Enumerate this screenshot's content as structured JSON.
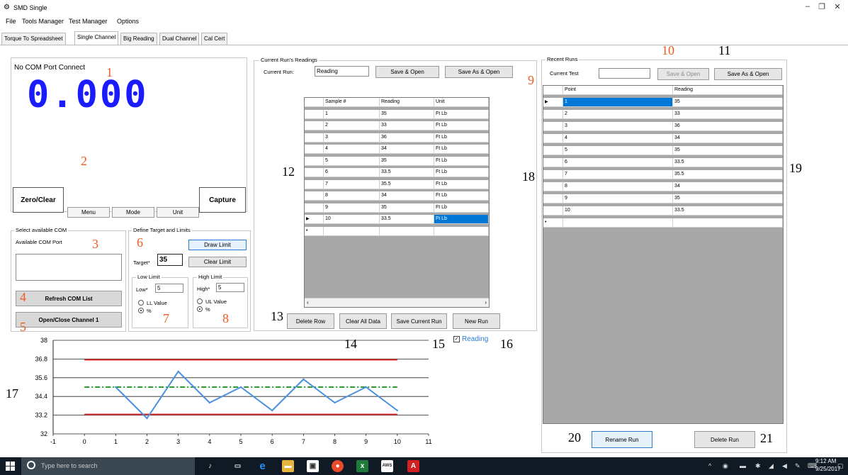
{
  "window": {
    "title": "SMD Single",
    "minimize": "–",
    "maximize": "❐",
    "close": "✕"
  },
  "menu": [
    "File",
    "Tools Manager",
    "Test Manager",
    "Options"
  ],
  "tabs": [
    "Torque To Spreadsheet",
    "Single Channel",
    "Big Reading",
    "Dual Channel",
    "Cal Cert"
  ],
  "display": {
    "status": "No COM Port Connect",
    "reading": "0.000",
    "zero_clear": "Zero/Clear",
    "capture": "Capture",
    "menu_btn": "Menu",
    "mode_btn": "Mode",
    "unit_btn": "Unit"
  },
  "com": {
    "group_title": "Select available COM",
    "label": "Available COM Port",
    "refresh": "Refresh COM List",
    "open_close": "Open/Close Channel 1"
  },
  "limits": {
    "group_title": "Define Target and Limits",
    "target_label": "Target*",
    "target_value": "35",
    "draw_limit": "Draw Limit",
    "clear_limit": "Clear Limit",
    "low_title": "Low Limit",
    "low_label": "Low*",
    "low_value": "5",
    "ll_value": "LL Value",
    "low_pct": "%",
    "high_title": "High Limit",
    "high_label": "High*",
    "high_value": "5",
    "ul_value": "UL Value",
    "high_pct": "%"
  },
  "current_run": {
    "group_title": "Current Run's Readings",
    "label": "Current Run:",
    "value": "Reading",
    "save_open": "Save & Open",
    "save_as_open": "Save As & Open",
    "columns": [
      "Sample #",
      "Reading",
      "Unit"
    ],
    "rows": [
      [
        "1",
        "35",
        "Ft Lb"
      ],
      [
        "2",
        "33",
        "Ft Lb"
      ],
      [
        "3",
        "36",
        "Ft Lb"
      ],
      [
        "4",
        "34",
        "Ft Lb"
      ],
      [
        "5",
        "35",
        "Ft Lb"
      ],
      [
        "6",
        "33.5",
        "Ft Lb"
      ],
      [
        "7",
        "35.5",
        "Ft Lb"
      ],
      [
        "8",
        "34",
        "Ft Lb"
      ],
      [
        "9",
        "35",
        "Ft Lb"
      ],
      [
        "10",
        "33.5",
        "Ft Lb"
      ]
    ],
    "delete_row": "Delete Row",
    "clear_all": "Clear All Data",
    "save_current": "Save Current Run",
    "new_run": "New Run",
    "reading_checkbox": "Reading"
  },
  "recent_runs": {
    "group_title": "Recent Runs",
    "label": "Current Test",
    "save_open": "Save & Open",
    "save_as_open": "Save As & Open",
    "columns": [
      "Point",
      "Reading"
    ],
    "rows": [
      [
        "1",
        "35"
      ],
      [
        "2",
        "33"
      ],
      [
        "3",
        "36"
      ],
      [
        "4",
        "34"
      ],
      [
        "5",
        "35"
      ],
      [
        "6",
        "33.5"
      ],
      [
        "7",
        "35.5"
      ],
      [
        "8",
        "34"
      ],
      [
        "9",
        "35"
      ],
      [
        "10",
        "33.5"
      ]
    ],
    "rename": "Rename Run",
    "delete": "Delete Run"
  },
  "annotations": [
    "1",
    "2",
    "3",
    "4",
    "5",
    "6",
    "7",
    "8",
    "9",
    "10",
    "11",
    "12",
    "13",
    "14",
    "15",
    "16",
    "17",
    "18",
    "19",
    "20",
    "21"
  ],
  "chart_data": {
    "type": "line",
    "x_ticks": [
      "-1",
      "0",
      "1",
      "2",
      "3",
      "4",
      "5",
      "6",
      "7",
      "8",
      "9",
      "10",
      "11"
    ],
    "y_ticks": [
      "38",
      "36.8",
      "35.6",
      "34.4",
      "33.2",
      "32"
    ],
    "xlim": [
      -1,
      11
    ],
    "ylim": [
      32,
      38
    ],
    "reading": {
      "x": [
        1,
        2,
        3,
        4,
        5,
        6,
        7,
        8,
        9,
        10
      ],
      "y": [
        35,
        33,
        36,
        34,
        35,
        33.5,
        35.5,
        34,
        35,
        33.5
      ],
      "color": "#4a90e2"
    },
    "target": {
      "value": 35,
      "color": "#2e9b2e"
    },
    "upper_limit": {
      "value": 36.75,
      "color": "#e03030"
    },
    "lower_limit": {
      "value": 33.25,
      "color": "#e03030"
    },
    "grid": "horizontal"
  },
  "taskbar": {
    "search_placeholder": "Type here to search",
    "time": "9:12 AM",
    "date": "9/25/2017"
  }
}
